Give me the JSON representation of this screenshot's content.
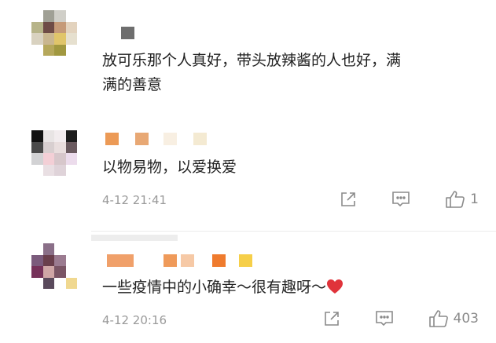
{
  "comments": [
    {
      "text": "放可乐那个人真好，带头放辣酱的人也好，满满的善意",
      "text_line1": "放可乐那个人真好，带头放辣酱的人也好，满",
      "text_line2": "满的善意"
    },
    {
      "text": "以物易物，以爱换爱",
      "date": "4-12 21:41",
      "like_count": "1"
    },
    {
      "text": "一些疫情中的小确幸～很有趣呀～",
      "date": "4-12 20:16",
      "like_count": "403"
    }
  ],
  "colors": {
    "heart": "#e0333a",
    "meta_text": "#9a9a9a",
    "icon": "#8a8a8a"
  },
  "icons": {
    "share": "share-icon",
    "comment": "comment-icon",
    "like": "thumbs-up-icon",
    "emoji": "red-heart-emoji"
  }
}
